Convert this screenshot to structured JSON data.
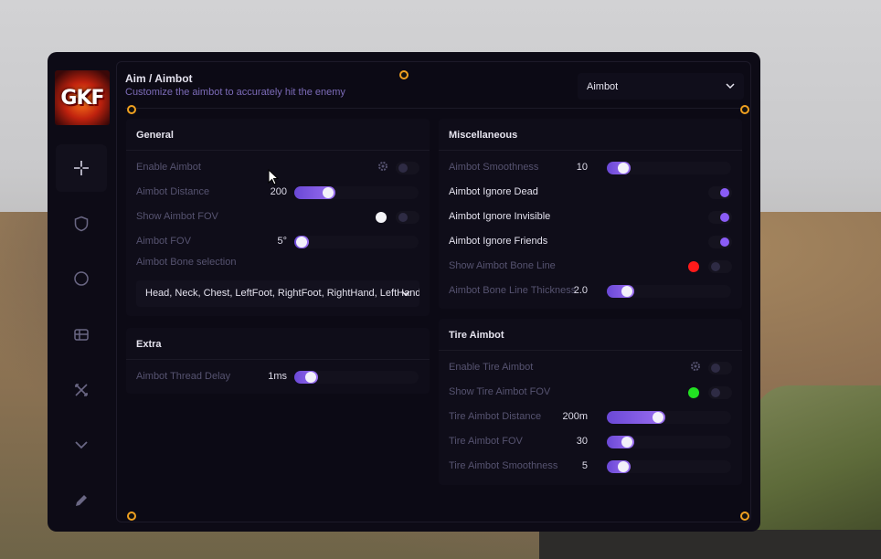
{
  "header": {
    "title": "Aim / Aimbot",
    "subtitle": "Customize the aimbot to accurately hit the enemy",
    "dropdown_value": "Aimbot"
  },
  "logo_text": "GKF",
  "colors": {
    "accent": "#8a5cf6",
    "bone_line_color": "#ff1a1a",
    "tire_fov_color": "#22e022",
    "knob": "#f0a020"
  },
  "sidebar": {
    "items": [
      {
        "icon": "crosshair-icon",
        "active": true
      },
      {
        "icon": "shield-icon"
      },
      {
        "icon": "circle-icon"
      },
      {
        "icon": "gift-icon"
      },
      {
        "icon": "tools-icon"
      },
      {
        "icon": "chevron-down-icon"
      },
      {
        "icon": "pencil-icon"
      }
    ]
  },
  "general": {
    "title": "General",
    "enable_aimbot": "Enable Aimbot",
    "aimbot_distance": {
      "label": "Aimbot Distance",
      "value": "200",
      "level": 0.24
    },
    "show_fov": "Show Aimbot FOV",
    "aimbot_fov": {
      "label": "Aimbot FOV",
      "value": "5°",
      "level": 0.0
    },
    "bone_selection_label": "Aimbot Bone selection",
    "bone_selection_value": "Head, Neck, Chest, LeftFoot, RightFoot, RightHand, LeftHand"
  },
  "extra": {
    "title": "Extra",
    "thread_delay": {
      "label": "Aimbot Thread Delay",
      "value": "1ms",
      "level": 0.08
    }
  },
  "misc": {
    "title": "Miscellaneous",
    "smoothness": {
      "label": "Aimbot Smoothness",
      "value": "10",
      "level": 0.08
    },
    "ignore_dead": "Aimbot Ignore Dead",
    "ignore_invisible": "Aimbot Ignore Invisible",
    "ignore_friends": "Aimbot Ignore Friends",
    "show_bone_line": "Show Aimbot Bone Line",
    "bone_line_thickness": {
      "label": "Aimbot Bone Line Thickness",
      "value": "2.0",
      "level": 0.12
    }
  },
  "tire": {
    "title": "Tire Aimbot",
    "enable": "Enable Tire Aimbot",
    "show_fov": "Show Tire Aimbot FOV",
    "distance": {
      "label": "Tire Aimbot Distance",
      "value": "200m",
      "level": 0.4
    },
    "fov": {
      "label": "Tire Aimbot FOV",
      "value": "30",
      "level": 0.12
    },
    "smoothness": {
      "label": "Tire Aimbot Smoothness",
      "value": "5",
      "level": 0.08
    }
  }
}
